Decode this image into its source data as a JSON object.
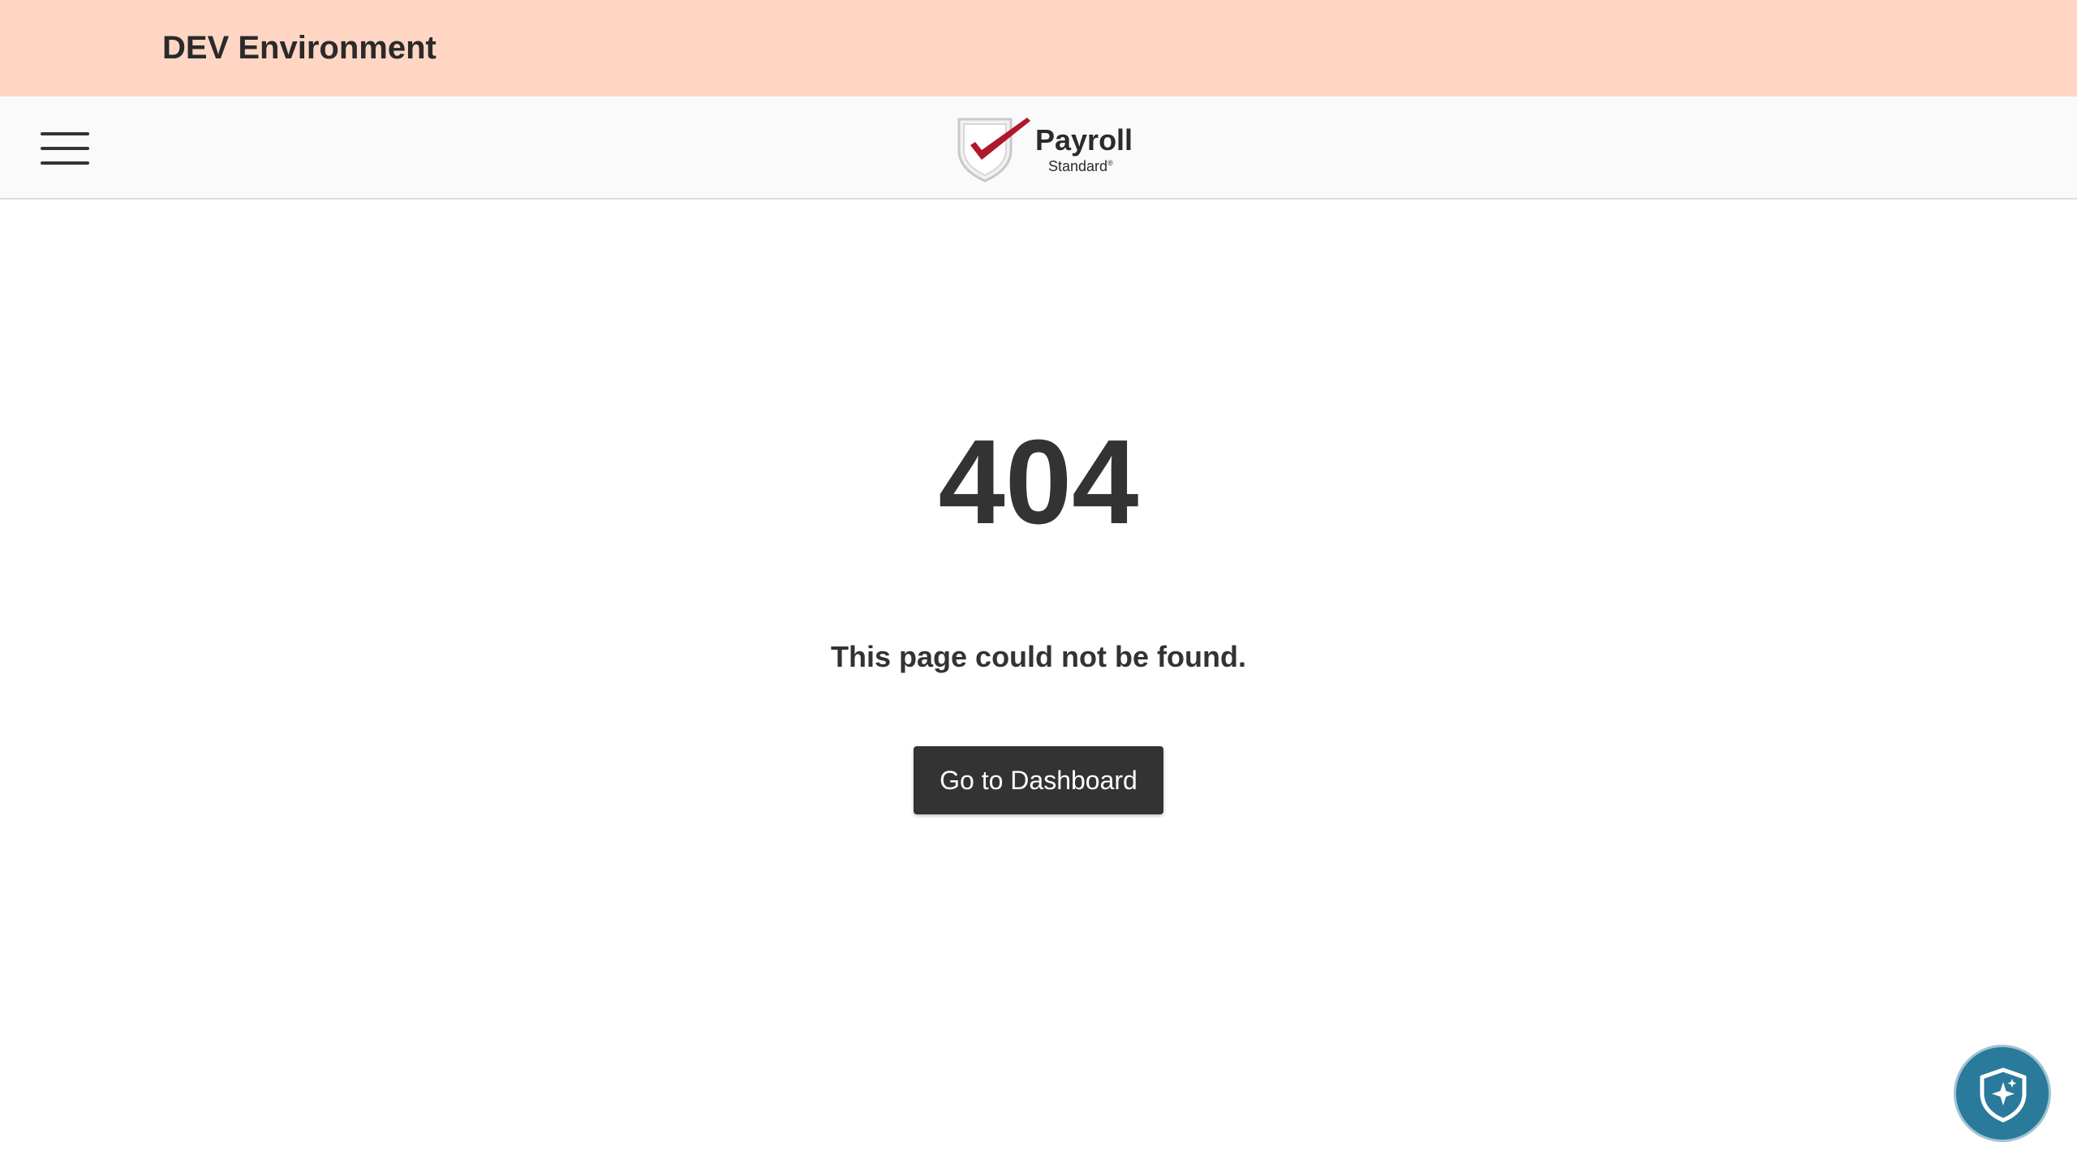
{
  "environment_banner": {
    "title": "DEV Environment",
    "background": "#ffd6c4"
  },
  "header": {
    "menu_icon": "hamburger-menu-icon",
    "logo": {
      "word": "Payroll",
      "sub": "Standard",
      "icon": "shield-checkmark-icon",
      "check_color": "#b0172a"
    }
  },
  "error": {
    "code": "404",
    "message": "This page could not be found.",
    "button_label": "Go to Dashboard"
  },
  "assistant": {
    "icon": "shield-sparkle-icon",
    "color": "#2a7a9b"
  }
}
